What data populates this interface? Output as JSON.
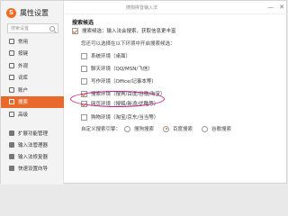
{
  "app": {
    "title": "属性设置",
    "window_title": "搜狗拼音输入法",
    "minimize": "—",
    "close": "✕"
  },
  "search": {
    "placeholder": "搜索设置"
  },
  "nav": {
    "items": [
      {
        "label": "常用",
        "icon": "common-icon"
      },
      {
        "label": "按键",
        "icon": "keyboard-icon"
      },
      {
        "label": "外观",
        "icon": "appearance-icon"
      },
      {
        "label": "词库",
        "icon": "dictionary-icon"
      },
      {
        "label": "账户",
        "icon": "account-icon"
      },
      {
        "label": "搜索",
        "icon": "search-icon",
        "active": true
      },
      {
        "label": "高级",
        "icon": "advanced-icon"
      }
    ]
  },
  "tools": {
    "items": [
      {
        "label": "扩展功能管理",
        "icon": "extension-icon"
      },
      {
        "label": "输入法管理器",
        "icon": "ime-manager-icon"
      },
      {
        "label": "输入法修复器",
        "icon": "ime-repair-icon"
      },
      {
        "label": "快速设置向导",
        "icon": "wizard-icon"
      }
    ]
  },
  "content": {
    "section_title": "搜索候选",
    "main_option": {
      "label": "搜索候选：输入法会搜索，获取信息更丰富",
      "checked": true
    },
    "env_prompt": "您还可以选择在以下环境中开启搜索候选：",
    "env_options": [
      {
        "label": "系统环境（桌面）",
        "checked": false
      },
      {
        "label": "聊天环境（QQ/MSN/飞信）",
        "checked": false
      },
      {
        "label": "写作环境（Office/记事本等）",
        "checked": false
      },
      {
        "label": "搜索环境（搜狗/百度/谷歌/淘宝）",
        "checked": true
      },
      {
        "label": "网页环境（搜狐/新浪/优酷等）",
        "checked": true
      },
      {
        "label": "购物环境（淘宝/京东/当当等）",
        "checked": false
      }
    ],
    "engine_prompt": "自定义搜索引擎：",
    "engines": [
      {
        "label": "搜狗搜索",
        "checked": false
      },
      {
        "label": "百度搜索",
        "checked": true
      },
      {
        "label": "谷歌搜索",
        "checked": false
      }
    ]
  }
}
